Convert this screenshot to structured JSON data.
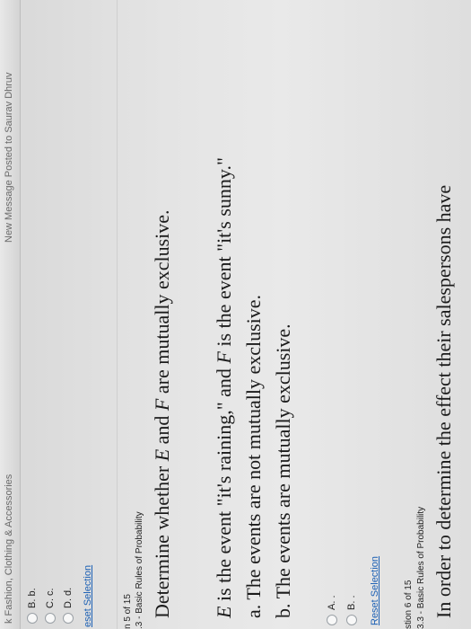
{
  "browser": {
    "tab_left": "k Fashion, Clothing & Accessories",
    "tab_right": "New Message Posted to Saurav Dhruv"
  },
  "previous_question": {
    "options": [
      {
        "radio": "",
        "label": "B. b."
      },
      {
        "radio": "",
        "label": "C. c."
      },
      {
        "radio": "",
        "label": "D. d."
      }
    ],
    "reset_label": "eset Selection"
  },
  "question5": {
    "number": "n 5 of 15",
    "section": ".3 - Basic Rules of Probability",
    "prompt_pre": "Determine whether ",
    "prompt_e": "E",
    "prompt_mid": " and ",
    "prompt_f": "F",
    "prompt_post": " are mutually exclusive.",
    "given_e": "E",
    "given_text1": " is the event \"it's raining,\" and ",
    "given_f": "F",
    "given_text2": " is the event \"it's sunny.\"",
    "choice_a": "a. The events are not mutually exclusive.",
    "choice_b": "b. The events are mutually exclusive.",
    "options": [
      {
        "label": "A. ."
      },
      {
        "label": "B. ."
      }
    ],
    "reset_label": "Reset Selection"
  },
  "question6": {
    "number": "stion 6 of 15",
    "section": "3.3 - Basic Rules of Probability",
    "prompt_partial": "In order to determine the effect their salespersons have"
  }
}
